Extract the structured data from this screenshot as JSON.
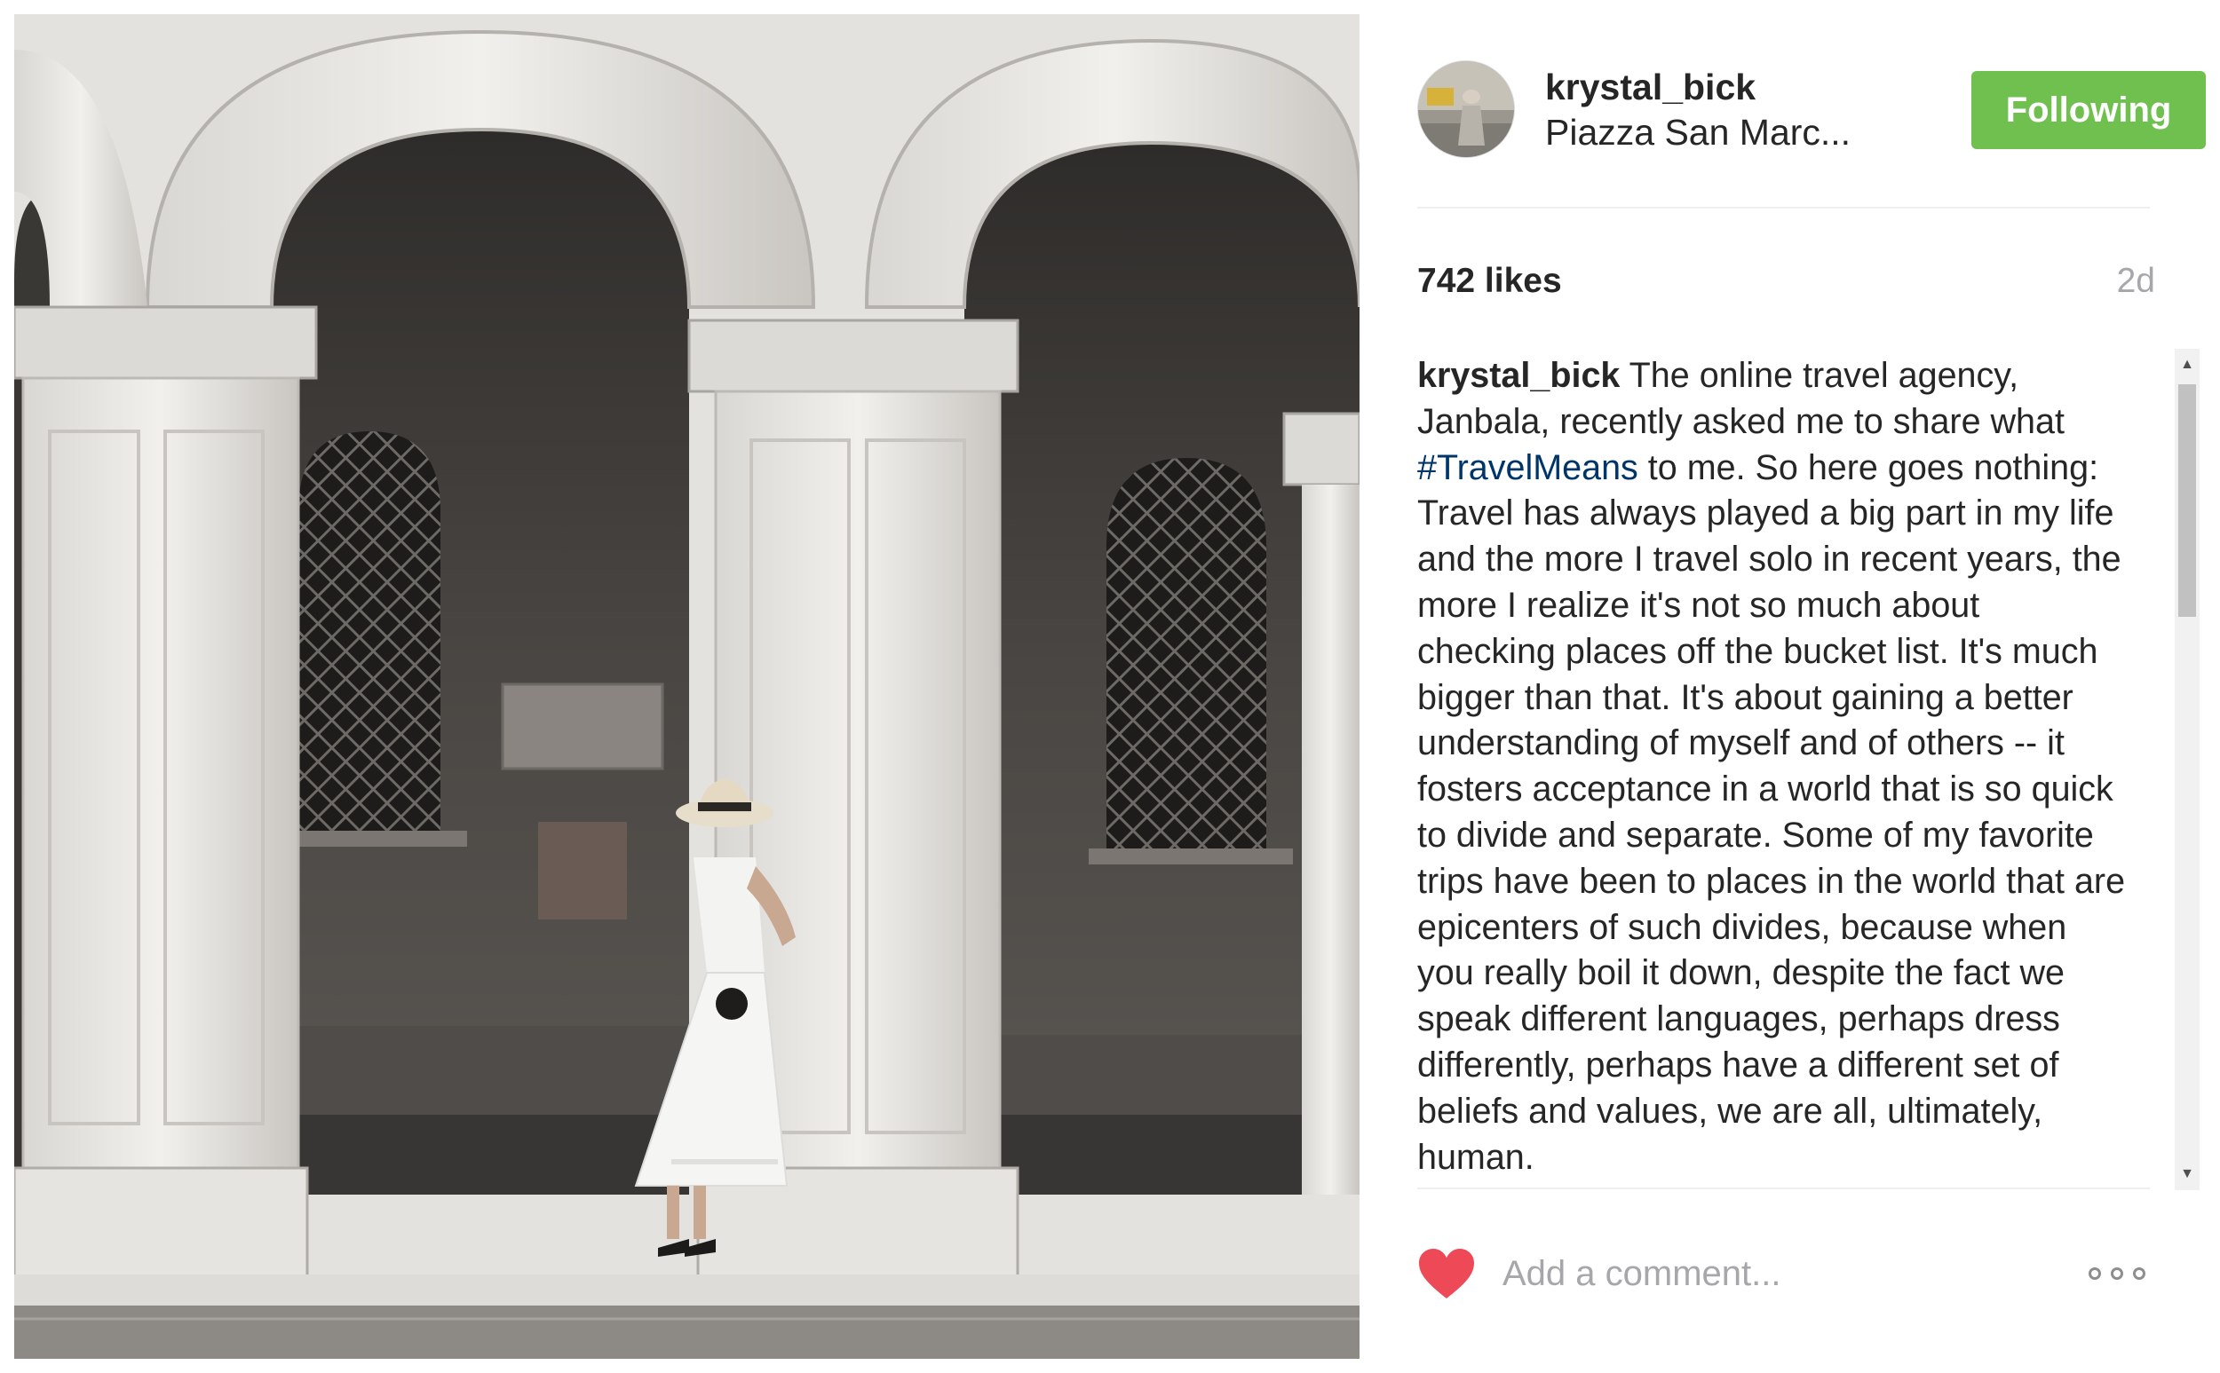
{
  "post": {
    "image_alt": "Woman in white dress and straw hat leaning against a marble column under stone arches",
    "author": {
      "username": "krystal_bick",
      "location": "Piazza San Marc..."
    },
    "follow_button_label": "Following",
    "likes": "742 likes",
    "timestamp": "2d",
    "caption": {
      "username": "krystal_bick",
      "text_before_hashtag": " The online travel agency, Janbala, recently asked me to share what ",
      "hashtag": "#TravelMeans",
      "text_after_hashtag": " to me. So here goes nothing: Travel has always played a big part in my life and the more I travel solo in recent years, the more I realize it's not so much about checking places off the bucket list. It's much bigger than that. It's about gaining a better understanding of myself and of others -- it fosters acceptance in a world that is so quick to divide and separate. Some of my favorite trips have been to places in the world that are epicenters of such divides, because when you really boil it down, despite the fact we speak different languages, perhaps dress differently, perhaps have a different set of beliefs and values, we are all, ultimately, human."
    },
    "comment_placeholder": "Add a comment...",
    "colors": {
      "follow_button": "#70c050",
      "heart": "#ed4956",
      "hashtag": "#003569",
      "timestamp": "#a5a7aa"
    }
  }
}
